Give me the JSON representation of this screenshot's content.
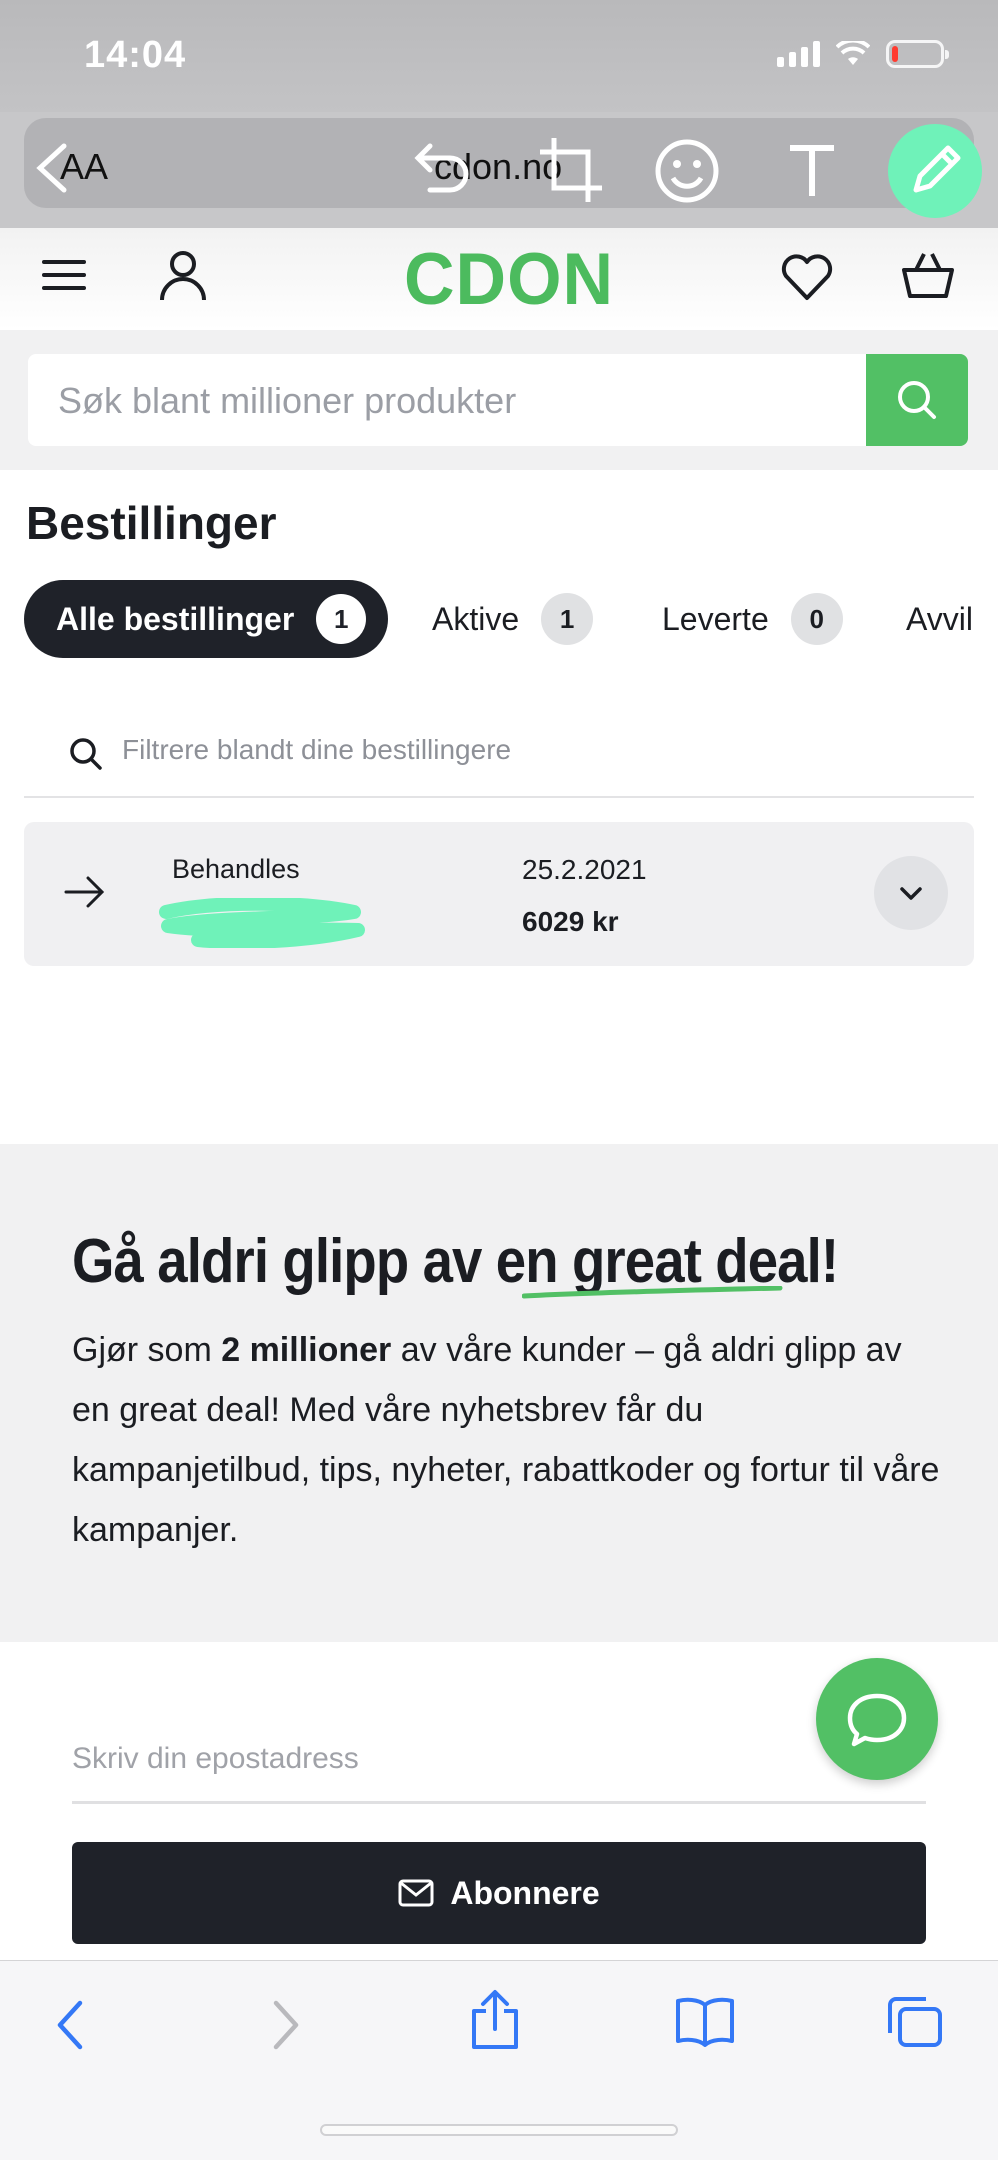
{
  "status_bar": {
    "time": "14:04"
  },
  "browser": {
    "text_size_label": "AA",
    "url": "cdon.no"
  },
  "header": {
    "logo": "CDON"
  },
  "search": {
    "placeholder": "Søk blant millioner produkter"
  },
  "orders": {
    "title": "Bestillinger",
    "tabs": [
      {
        "label": "Alle bestillinger",
        "count": "1"
      },
      {
        "label": "Aktive",
        "count": "1"
      },
      {
        "label": "Leverte",
        "count": "0"
      },
      {
        "label": "Avvil",
        "count": ""
      }
    ],
    "filter_placeholder": "Filtrere blandt dine bestillingere",
    "items": [
      {
        "status": "Behandles",
        "date": "25.2.2021",
        "amount": "6029 kr"
      }
    ]
  },
  "newsletter": {
    "title_part1": "Gå aldri glipp av en ",
    "title_highlight": "great deal!",
    "text_before": "Gjør som ",
    "text_bold": "2 millioner",
    "text_after": " av våre kunder – gå aldri glipp av en great deal! Med våre nyhetsbrev får du kampanjetilbud, tips, nyheter, rabattkoder og fortur til våre kampanjer.",
    "email_placeholder": "Skriv din epostadress",
    "subscribe_label": "Abonnere"
  },
  "colors": {
    "brand_green": "#52c065",
    "dark": "#1f2229",
    "markup_green": "#6ff2b9"
  }
}
